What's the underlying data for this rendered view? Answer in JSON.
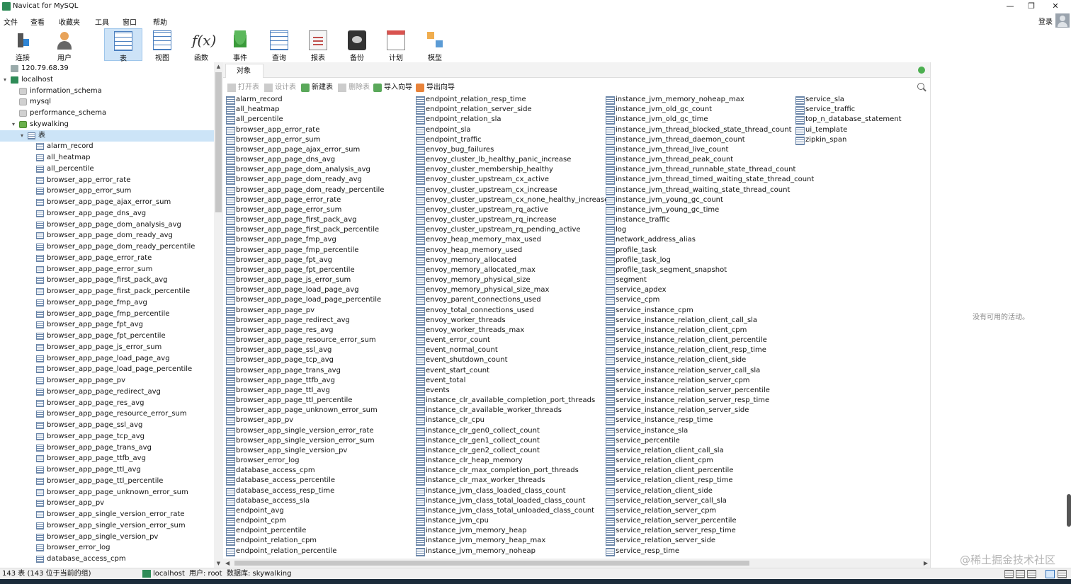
{
  "window": {
    "title": "Navicat for MySQL",
    "minimize": "—",
    "maximize": "❐",
    "close": "✕"
  },
  "menu": [
    "文件",
    "查看",
    "收藏夹",
    "工具",
    "窗口",
    "帮助"
  ],
  "login_label": "登录",
  "toolbar": [
    {
      "label": "连接",
      "icon": "connection-icon"
    },
    {
      "label": "用户",
      "icon": "user-icon"
    },
    {
      "label": "表",
      "icon": "table-icon",
      "active": true
    },
    {
      "label": "视图",
      "icon": "view-icon"
    },
    {
      "label": "函数",
      "icon": "function-icon"
    },
    {
      "label": "事件",
      "icon": "event-icon"
    },
    {
      "label": "查询",
      "icon": "query-icon"
    },
    {
      "label": "报表",
      "icon": "report-icon"
    },
    {
      "label": "备份",
      "icon": "backup-icon"
    },
    {
      "label": "计划",
      "icon": "schedule-icon"
    },
    {
      "label": "模型",
      "icon": "model-icon"
    }
  ],
  "tree": {
    "connections": [
      {
        "name": "120.79.68.39",
        "open": false
      },
      {
        "name": "localhost",
        "open": true,
        "databases": [
          "information_schema",
          "mysql",
          "performance_schema",
          "skywalking"
        ],
        "open_database": "skywalking",
        "tables_node": "表",
        "tables": [
          "alarm_record",
          "all_heatmap",
          "all_percentile",
          "browser_app_error_rate",
          "browser_app_error_sum",
          "browser_app_page_ajax_error_sum",
          "browser_app_page_dns_avg",
          "browser_app_page_dom_analysis_avg",
          "browser_app_page_dom_ready_avg",
          "browser_app_page_dom_ready_percentile",
          "browser_app_page_error_rate",
          "browser_app_page_error_sum",
          "browser_app_page_first_pack_avg",
          "browser_app_page_first_pack_percentile",
          "browser_app_page_fmp_avg",
          "browser_app_page_fmp_percentile",
          "browser_app_page_fpt_avg",
          "browser_app_page_fpt_percentile",
          "browser_app_page_js_error_sum",
          "browser_app_page_load_page_avg",
          "browser_app_page_load_page_percentile",
          "browser_app_page_pv",
          "browser_app_page_redirect_avg",
          "browser_app_page_res_avg",
          "browser_app_page_resource_error_sum",
          "browser_app_page_ssl_avg",
          "browser_app_page_tcp_avg",
          "browser_app_page_trans_avg",
          "browser_app_page_ttfb_avg",
          "browser_app_page_ttl_avg",
          "browser_app_page_ttl_percentile",
          "browser_app_page_unknown_error_sum",
          "browser_app_pv",
          "browser_app_single_version_error_rate",
          "browser_app_single_version_error_sum",
          "browser_app_single_version_pv",
          "browser_error_log",
          "database_access_cpm"
        ]
      }
    ]
  },
  "object_tab": "对象",
  "object_toolbar": [
    {
      "label": "打开表",
      "enabled": false
    },
    {
      "label": "设计表",
      "enabled": false
    },
    {
      "label": "新建表",
      "enabled": true
    },
    {
      "label": "删除表",
      "enabled": false
    },
    {
      "label": "导入向导",
      "enabled": true
    },
    {
      "label": "导出向导",
      "enabled": true
    }
  ],
  "object_columns": [
    [
      "alarm_record",
      "all_heatmap",
      "all_percentile",
      "browser_app_error_rate",
      "browser_app_error_sum",
      "browser_app_page_ajax_error_sum",
      "browser_app_page_dns_avg",
      "browser_app_page_dom_analysis_avg",
      "browser_app_page_dom_ready_avg",
      "browser_app_page_dom_ready_percentile",
      "browser_app_page_error_rate",
      "browser_app_page_error_sum",
      "browser_app_page_first_pack_avg",
      "browser_app_page_first_pack_percentile",
      "browser_app_page_fmp_avg",
      "browser_app_page_fmp_percentile",
      "browser_app_page_fpt_avg",
      "browser_app_page_fpt_percentile",
      "browser_app_page_js_error_sum",
      "browser_app_page_load_page_avg",
      "browser_app_page_load_page_percentile",
      "browser_app_page_pv",
      "browser_app_page_redirect_avg",
      "browser_app_page_res_avg",
      "browser_app_page_resource_error_sum",
      "browser_app_page_ssl_avg",
      "browser_app_page_tcp_avg",
      "browser_app_page_trans_avg",
      "browser_app_page_ttfb_avg",
      "browser_app_page_ttl_avg",
      "browser_app_page_ttl_percentile",
      "browser_app_page_unknown_error_sum",
      "browser_app_pv",
      "browser_app_single_version_error_rate",
      "browser_app_single_version_error_sum",
      "browser_app_single_version_pv",
      "browser_error_log",
      "database_access_cpm",
      "database_access_percentile",
      "database_access_resp_time",
      "database_access_sla",
      "endpoint_avg",
      "endpoint_cpm",
      "endpoint_percentile",
      "endpoint_relation_cpm",
      "endpoint_relation_percentile"
    ],
    [
      "endpoint_relation_resp_time",
      "endpoint_relation_server_side",
      "endpoint_relation_sla",
      "endpoint_sla",
      "endpoint_traffic",
      "envoy_bug_failures",
      "envoy_cluster_lb_healthy_panic_increase",
      "envoy_cluster_membership_healthy",
      "envoy_cluster_upstream_cx_active",
      "envoy_cluster_upstream_cx_increase",
      "envoy_cluster_upstream_cx_none_healthy_increase",
      "envoy_cluster_upstream_rq_active",
      "envoy_cluster_upstream_rq_increase",
      "envoy_cluster_upstream_rq_pending_active",
      "envoy_heap_memory_max_used",
      "envoy_heap_memory_used",
      "envoy_memory_allocated",
      "envoy_memory_allocated_max",
      "envoy_memory_physical_size",
      "envoy_memory_physical_size_max",
      "envoy_parent_connections_used",
      "envoy_total_connections_used",
      "envoy_worker_threads",
      "envoy_worker_threads_max",
      "event_error_count",
      "event_normal_count",
      "event_shutdown_count",
      "event_start_count",
      "event_total",
      "events",
      "instance_clr_available_completion_port_threads",
      "instance_clr_available_worker_threads",
      "instance_clr_cpu",
      "instance_clr_gen0_collect_count",
      "instance_clr_gen1_collect_count",
      "instance_clr_gen2_collect_count",
      "instance_clr_heap_memory",
      "instance_clr_max_completion_port_threads",
      "instance_clr_max_worker_threads",
      "instance_jvm_class_loaded_class_count",
      "instance_jvm_class_total_loaded_class_count",
      "instance_jvm_class_total_unloaded_class_count",
      "instance_jvm_cpu",
      "instance_jvm_memory_heap",
      "instance_jvm_memory_heap_max",
      "instance_jvm_memory_noheap"
    ],
    [
      "instance_jvm_memory_noheap_max",
      "instance_jvm_old_gc_count",
      "instance_jvm_old_gc_time",
      "instance_jvm_thread_blocked_state_thread_count",
      "instance_jvm_thread_daemon_count",
      "instance_jvm_thread_live_count",
      "instance_jvm_thread_peak_count",
      "instance_jvm_thread_runnable_state_thread_count",
      "instance_jvm_thread_timed_waiting_state_thread_count",
      "instance_jvm_thread_waiting_state_thread_count",
      "instance_jvm_young_gc_count",
      "instance_jvm_young_gc_time",
      "instance_traffic",
      "log",
      "network_address_alias",
      "profile_task",
      "profile_task_log",
      "profile_task_segment_snapshot",
      "segment",
      "service_apdex",
      "service_cpm",
      "service_instance_cpm",
      "service_instance_relation_client_call_sla",
      "service_instance_relation_client_cpm",
      "service_instance_relation_client_percentile",
      "service_instance_relation_client_resp_time",
      "service_instance_relation_client_side",
      "service_instance_relation_server_call_sla",
      "service_instance_relation_server_cpm",
      "service_instance_relation_server_percentile",
      "service_instance_relation_server_resp_time",
      "service_instance_relation_server_side",
      "service_instance_resp_time",
      "service_instance_sla",
      "service_percentile",
      "service_relation_client_call_sla",
      "service_relation_client_cpm",
      "service_relation_client_percentile",
      "service_relation_client_resp_time",
      "service_relation_client_side",
      "service_relation_server_call_sla",
      "service_relation_server_cpm",
      "service_relation_server_percentile",
      "service_relation_server_resp_time",
      "service_relation_server_side",
      "service_resp_time"
    ],
    [
      "service_sla",
      "service_traffic",
      "top_n_database_statement",
      "ui_template",
      "zipkin_span"
    ]
  ],
  "info_message": "没有可用的活动。",
  "status": {
    "count": "143 表 (143 位于当前的组)",
    "connection": "localhost",
    "user": "用户: root",
    "database": "数据库: skywalking"
  },
  "watermark": "@稀土掘金技术社区",
  "colors": {
    "selection": "#cce4f7",
    "active_tool": "#cde3f7",
    "server_icon": "#2e8b57"
  }
}
